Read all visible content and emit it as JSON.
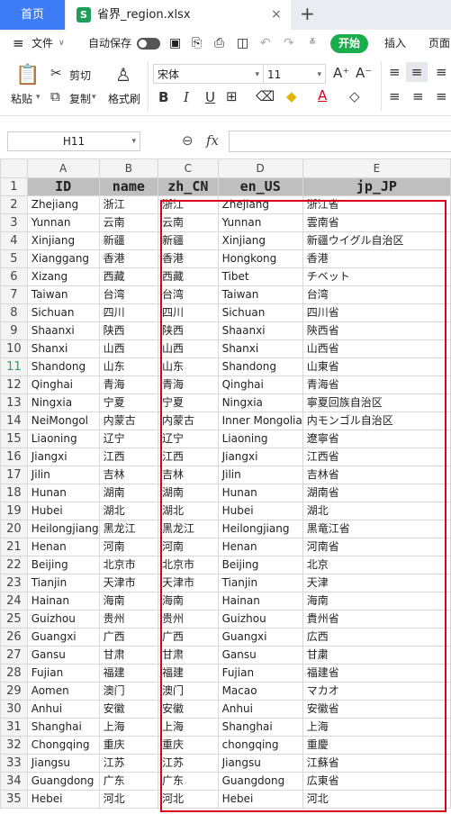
{
  "tabs": {
    "home": "首页",
    "file_icon": "S",
    "file": "省界_region.xlsx",
    "close": "×",
    "add": "+"
  },
  "menu": {
    "menu_icon": "≡",
    "file": "文件",
    "autosave": "自动保存",
    "start": "开始",
    "insert": "插入",
    "page": "页面"
  },
  "ribbon": {
    "paste": "粘贴",
    "cut": "剪切",
    "copy": "复制",
    "format_painter": "格式刷",
    "font": "宋体",
    "size": "11",
    "bold": "B",
    "italic": "I",
    "underline": "U"
  },
  "formula": {
    "cell": "H11",
    "fx": "fx"
  },
  "columns": [
    "A",
    "B",
    "C",
    "D",
    "E"
  ],
  "header": [
    "ID",
    "name",
    "zh_CN",
    "en_US",
    "jp_JP"
  ],
  "rows": [
    [
      "Zhejiang",
      "浙江",
      "浙江",
      "Zhejiang",
      "浙江省"
    ],
    [
      "Yunnan",
      "云南",
      "云南",
      "Yunnan",
      "雲南省"
    ],
    [
      "Xinjiang",
      "新疆",
      "新疆",
      "Xinjiang",
      "新疆ウイグル自治区"
    ],
    [
      "Xianggang",
      "香港",
      "香港",
      "Hongkong",
      "香港"
    ],
    [
      "Xizang",
      "西藏",
      "西藏",
      "Tibet",
      "チベット"
    ],
    [
      "Taiwan",
      "台湾",
      "台湾",
      "Taiwan",
      "台湾"
    ],
    [
      "Sichuan",
      "四川",
      "四川",
      "Sichuan",
      "四川省"
    ],
    [
      "Shaanxi",
      "陕西",
      "陕西",
      "Shaanxi",
      "陝西省"
    ],
    [
      "Shanxi",
      "山西",
      "山西",
      "Shanxi",
      "山西省"
    ],
    [
      "Shandong",
      "山东",
      "山东",
      "Shandong",
      "山東省"
    ],
    [
      "Qinghai",
      "青海",
      "青海",
      "Qinghai",
      "青海省"
    ],
    [
      "Ningxia",
      "宁夏",
      "宁夏",
      "Ningxia",
      "寧夏回族自治区"
    ],
    [
      "NeiMongol",
      "内蒙古",
      "内蒙古",
      "Inner Mongolia",
      "内モンゴル自治区"
    ],
    [
      "Liaoning",
      "辽宁",
      "辽宁",
      "Liaoning",
      "遼寧省"
    ],
    [
      "Jiangxi",
      "江西",
      "江西",
      "Jiangxi",
      "江西省"
    ],
    [
      "Jilin",
      "吉林",
      "吉林",
      "Jilin",
      "吉林省"
    ],
    [
      "Hunan",
      "湖南",
      "湖南",
      "Hunan",
      "湖南省"
    ],
    [
      "Hubei",
      "湖北",
      "湖北",
      "Hubei",
      "湖北"
    ],
    [
      "Heilongjiang",
      "黑龙江",
      "黑龙江",
      "Heilongjiang",
      "黒竜江省"
    ],
    [
      "Henan",
      "河南",
      "河南",
      "Henan",
      "河南省"
    ],
    [
      "Beijing",
      "北京市",
      "北京市",
      "Beijing",
      "北京"
    ],
    [
      "Tianjin",
      "天津市",
      "天津市",
      "Tianjin",
      "天津"
    ],
    [
      "Hainan",
      "海南",
      "海南",
      "Hainan",
      "海南"
    ],
    [
      "Guizhou",
      "贵州",
      "贵州",
      "Guizhou",
      "貴州省"
    ],
    [
      "Guangxi",
      "广西",
      "广西",
      "Guangxi",
      "広西"
    ],
    [
      "Gansu",
      "甘肃",
      "甘肃",
      "Gansu",
      "甘粛"
    ],
    [
      "Fujian",
      "福建",
      "福建",
      "Fujian",
      "福建省"
    ],
    [
      "Aomen",
      "澳门",
      "澳门",
      "Macao",
      "マカオ"
    ],
    [
      "Anhui",
      "安徽",
      "安徽",
      "Anhui",
      "安徽省"
    ],
    [
      "Shanghai",
      "上海",
      "上海",
      "Shanghai",
      "上海"
    ],
    [
      "Chongqing",
      "重庆",
      "重庆",
      "chongqing",
      "重慶"
    ],
    [
      "Jiangsu",
      "江苏",
      "江苏",
      "Jiangsu",
      "江蘇省"
    ],
    [
      "Guangdong",
      "广东",
      "广东",
      "Guangdong",
      "広東省"
    ],
    [
      "Hebei",
      "河北",
      "河北",
      "Hebei",
      "河北"
    ]
  ]
}
